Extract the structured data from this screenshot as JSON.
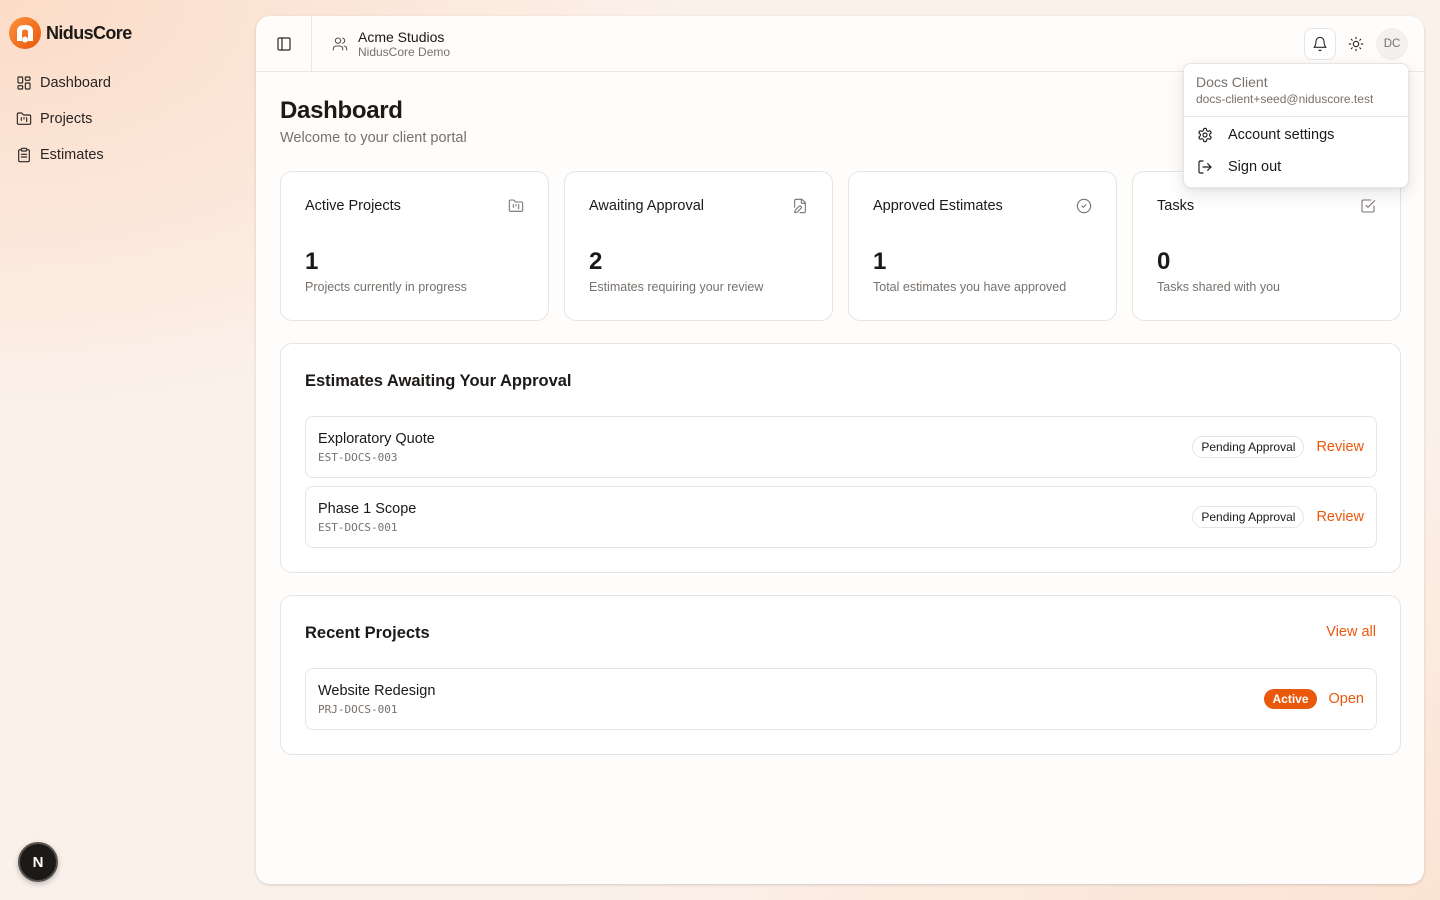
{
  "brand": {
    "name": "NidusCore"
  },
  "sidebar": {
    "items": [
      {
        "label": "Dashboard",
        "icon": "layout-dashboard-icon"
      },
      {
        "label": "Projects",
        "icon": "folder-icon"
      },
      {
        "label": "Estimates",
        "icon": "clipboard-icon"
      }
    ]
  },
  "devtools": {
    "label": "N"
  },
  "header": {
    "org_name": "Acme Studios",
    "org_sub": "NidusCore Demo",
    "avatar_initials": "DC"
  },
  "page": {
    "title": "Dashboard",
    "subtitle": "Welcome to your client portal"
  },
  "stats": [
    {
      "title": "Active Projects",
      "value": "1",
      "desc": "Projects currently in progress",
      "icon": "folder-kanban-icon"
    },
    {
      "title": "Awaiting Approval",
      "value": "2",
      "desc": "Estimates requiring your review",
      "icon": "file-pen-icon"
    },
    {
      "title": "Approved Estimates",
      "value": "1",
      "desc": "Total estimates you have approved",
      "icon": "check-circle-icon"
    },
    {
      "title": "Tasks",
      "value": "0",
      "desc": "Tasks shared with you",
      "icon": "check-square-icon"
    }
  ],
  "approvals": {
    "title": "Estimates Awaiting Your Approval",
    "rows": [
      {
        "name": "Exploratory Quote",
        "code": "EST-DOCS-003",
        "status": "Pending Approval",
        "action": "Review"
      },
      {
        "name": "Phase 1 Scope",
        "code": "EST-DOCS-001",
        "status": "Pending Approval",
        "action": "Review"
      }
    ]
  },
  "recent_projects": {
    "title": "Recent Projects",
    "view_all": "View all",
    "rows": [
      {
        "name": "Website Redesign",
        "code": "PRJ-DOCS-001",
        "status": "Active",
        "action": "Open"
      }
    ]
  },
  "user_menu": {
    "name": "Docs Client",
    "email": "docs-client+seed@niduscore.test",
    "items": [
      {
        "label": "Account settings",
        "icon": "gear-icon"
      },
      {
        "label": "Sign out",
        "icon": "log-out-icon"
      }
    ]
  },
  "colors": {
    "accent": "#ea580c",
    "brand_orange": "#f97316",
    "text": "#1c1917",
    "muted": "#78716c"
  }
}
